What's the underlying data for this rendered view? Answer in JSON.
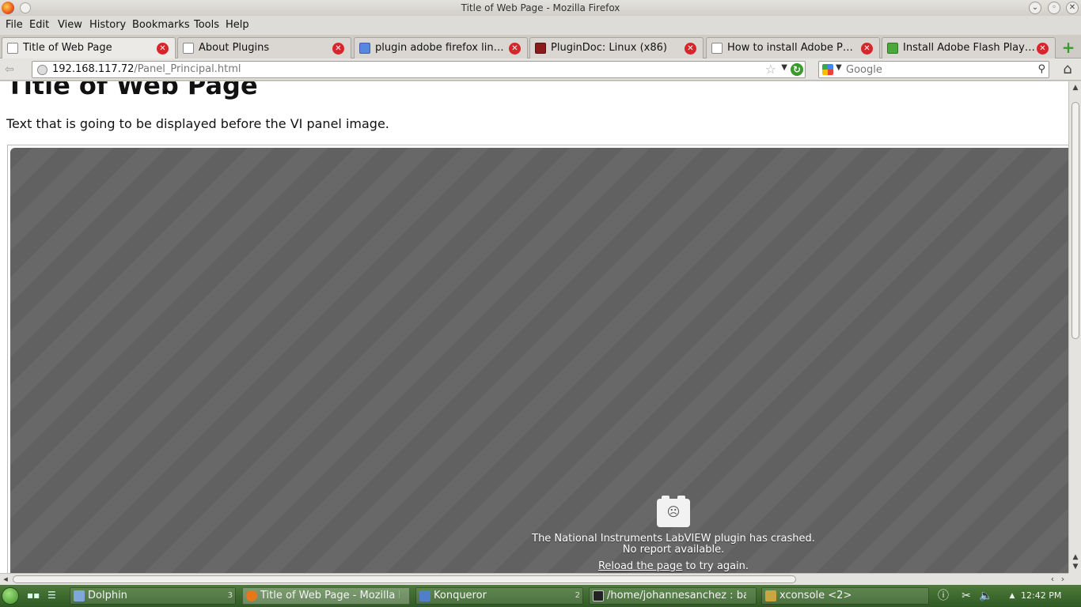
{
  "window": {
    "title": "Title of Web Page - Mozilla Firefox"
  },
  "menu": [
    "File",
    "Edit",
    "View",
    "History",
    "Bookmarks",
    "Tools",
    "Help"
  ],
  "tabs": [
    {
      "label": "Title of Web Page",
      "active": true
    },
    {
      "label": "About Plugins",
      "active": false
    },
    {
      "label": "plugin adobe firefox linux ...",
      "active": false
    },
    {
      "label": "PluginDoc: Linux (x86)",
      "active": false
    },
    {
      "label": "How to install Adobe PDF ...",
      "active": false
    },
    {
      "label": "Install Adobe Flash Player ...",
      "active": false
    }
  ],
  "nav": {
    "url_host": "192.168.117.72",
    "url_path": "/Panel_Principal.html",
    "search_placeholder": "Google"
  },
  "page": {
    "title": "Title of Web Page",
    "intro": "Text that is going to be displayed before the VI panel image.",
    "crash_line1": "The National Instruments LabVIEW plugin has crashed.",
    "crash_line2": "No report available.",
    "reload_link": "Reload the page",
    "reload_suffix": " to try again."
  },
  "taskbar": {
    "tasks": [
      {
        "label": "Dolphin",
        "count": "3"
      },
      {
        "label": "Title of Web Page - Mozilla Firefox",
        "count": ""
      },
      {
        "label": "Konqueror",
        "count": "2"
      },
      {
        "label": "/home/johannesanchez : bash",
        "count": ""
      },
      {
        "label": "xconsole <2>",
        "count": ""
      }
    ],
    "clock": "12:42 PM"
  }
}
